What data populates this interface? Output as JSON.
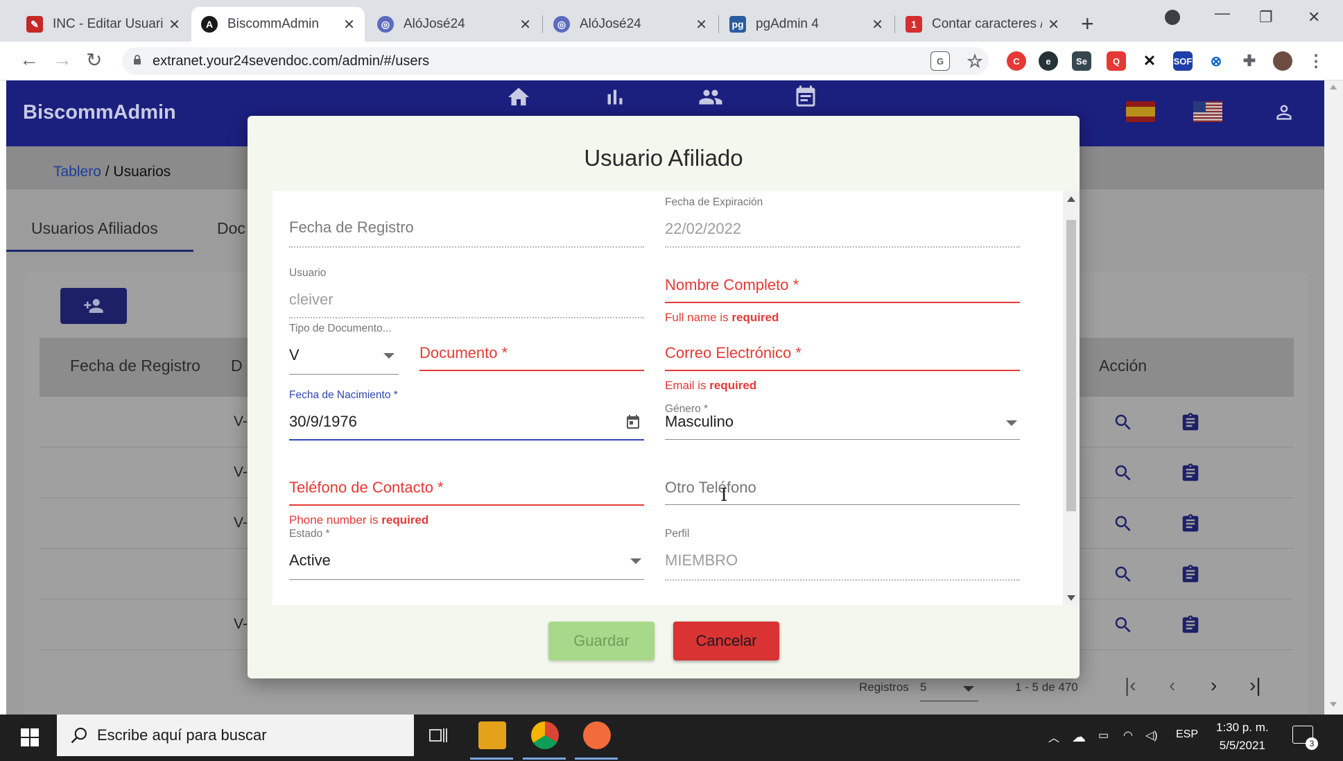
{
  "browser": {
    "tabs": [
      {
        "title": "INC - Editar Usuario",
        "active": false
      },
      {
        "title": "BiscommAdmin",
        "active": true
      },
      {
        "title": "AlóJosé24",
        "active": false
      },
      {
        "title": "AlóJosé24",
        "active": false
      },
      {
        "title": "pgAdmin 4",
        "active": false
      },
      {
        "title": "Contar caracteres /",
        "active": false
      }
    ],
    "url": "extranet.your24sevendoc.com/admin/#/users"
  },
  "app": {
    "brand": "BiscommAdmin",
    "breadcrumb": {
      "link": "Tablero",
      "separator": " / ",
      "current": "Usuarios"
    },
    "page_tabs": [
      "Usuarios Afiliados",
      "Doc"
    ],
    "table": {
      "headers": [
        "Fecha de Registro",
        "D",
        "Acción"
      ],
      "rows": [
        {
          "doc": "V-"
        },
        {
          "doc": "V-"
        },
        {
          "doc": "V-"
        },
        {
          "doc": ""
        },
        {
          "doc": "V-"
        }
      ]
    },
    "pagination": {
      "label": "Registros",
      "page_size": "5",
      "range": "1 - 5 de 470"
    }
  },
  "dialog": {
    "title": "Usuario Afiliado",
    "fields": {
      "fecha_registro": {
        "label": "Fecha de Registro"
      },
      "fecha_expiracion": {
        "label": "Fecha de Expiración",
        "value": "22/02/2022"
      },
      "usuario": {
        "label": "Usuario",
        "value": "cleiver"
      },
      "nombre_completo": {
        "label": "Nombre Completo *",
        "error_prefix": "Full name is ",
        "error_strong": "required"
      },
      "tipo_documento": {
        "label": "Tipo de Documento...",
        "value": "V"
      },
      "documento": {
        "label": "Documento *"
      },
      "correo": {
        "label": "Correo Electrónico *",
        "error_prefix": "Email is ",
        "error_strong": "required"
      },
      "fecha_nacimiento": {
        "label": "Fecha de Nacimiento *",
        "value": "30/9/1976"
      },
      "genero": {
        "label": "Género *",
        "value": "Masculino"
      },
      "telefono": {
        "label": "Teléfono de Contacto *",
        "error_prefix": "Phone number is ",
        "error_strong": "required"
      },
      "otro_telefono": {
        "label": "Otro Teléfono"
      },
      "estado": {
        "label": "Estado *",
        "value": "Active"
      },
      "perfil": {
        "label": "Perfil",
        "value": "MIEMBRO"
      }
    },
    "buttons": {
      "save": "Guardar",
      "cancel": "Cancelar"
    }
  },
  "taskbar": {
    "search_placeholder": "Escribe aquí para buscar",
    "lang": "ESP",
    "time": "1:30 p. m.",
    "date": "5/5/2021",
    "notifications": "3"
  },
  "colors": {
    "appbar": "#1b1f7e",
    "error": "#e53935",
    "focus": "#2f46b8",
    "save": "#a8d88a",
    "cancel": "#d93333"
  }
}
